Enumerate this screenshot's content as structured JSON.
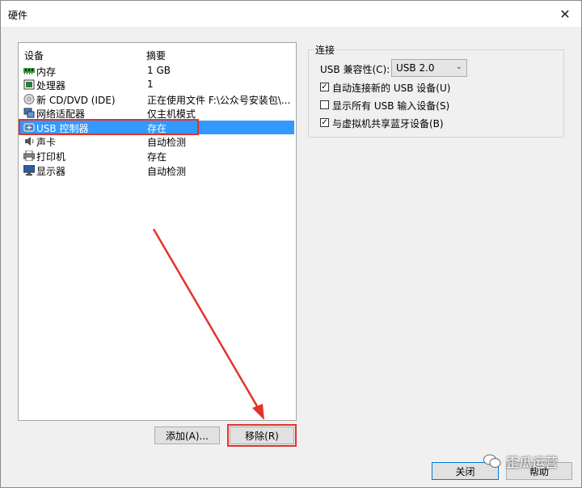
{
  "window": {
    "title": "硬件",
    "close_glyph": "✕"
  },
  "device_list": {
    "columns": {
      "device": "设备",
      "summary": "摘要"
    },
    "rows": [
      {
        "name": "内存",
        "summary": "1 GB",
        "icon": "memory-icon"
      },
      {
        "name": "处理器",
        "summary": "1",
        "icon": "processor-icon"
      },
      {
        "name": "新 CD/DVD (IDE)",
        "summary": "正在使用文件 F:\\公众号安装包\\...",
        "icon": "cd-dvd-icon"
      },
      {
        "name": "网络适配器",
        "summary": "仅主机模式",
        "icon": "network-adapter-icon"
      },
      {
        "name": "USB 控制器",
        "summary": "存在",
        "icon": "usb-controller-icon",
        "selected": true
      },
      {
        "name": "声卡",
        "summary": "自动检测",
        "icon": "sound-card-icon"
      },
      {
        "name": "打印机",
        "summary": "存在",
        "icon": "printer-icon"
      },
      {
        "name": "显示器",
        "summary": "自动检测",
        "icon": "display-icon"
      }
    ]
  },
  "buttons": {
    "add": "添加(A)...",
    "remove": "移除(R)",
    "close": "关闭",
    "help": "帮助"
  },
  "connection": {
    "title": "连接",
    "compat_label": "USB 兼容性(C):",
    "compat_value": "USB 2.0",
    "options": [
      {
        "label": "自动连接新的 USB 设备(U)",
        "checked": true
      },
      {
        "label": "显示所有 USB 输入设备(S)",
        "checked": false
      },
      {
        "label": "与虚拟机共享蓝牙设备(B)",
        "checked": true
      }
    ]
  },
  "watermark": {
    "text": "歪瓜运营"
  },
  "colors": {
    "selection": "#3399ff",
    "annotation": "#e2332a"
  }
}
